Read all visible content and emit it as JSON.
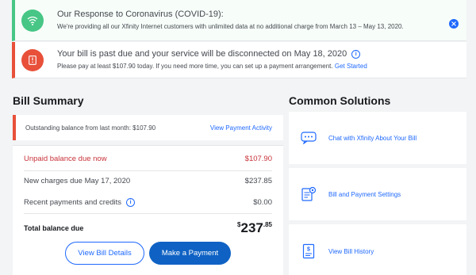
{
  "alerts": {
    "covid": {
      "title": "Our Response to Coronavirus (COVID-19):",
      "body": "We're providing all our Xfinity Internet customers with unlimited data at no additional charge from March 13 – May 13, 2020.",
      "icon": "wifi-icon"
    },
    "bill": {
      "title": "Your bill is past due and your service will be disconnected on May 18, 2020",
      "body": "Please pay at least $107.90 today. If you need more time, you can set up a payment arrangement.",
      "link": "Get Started",
      "icon": "bill-alert-icon"
    }
  },
  "bill_summary": {
    "heading": "Bill Summary",
    "outstanding": {
      "label": "Outstanding balance from last month: $107.90",
      "link": "View Payment Activity"
    },
    "rows": [
      {
        "label": "Unpaid balance due now",
        "value": "$107.90"
      },
      {
        "label": "New charges due May 17, 2020",
        "value": "$237.85"
      },
      {
        "label": "Recent payments and credits",
        "value": "$0.00"
      }
    ],
    "total": {
      "label": "Total balance due",
      "currency": "$",
      "dollars": "237",
      "cents": ".85"
    },
    "buttons": {
      "details": "View Bill Details",
      "pay": "Make a Payment"
    }
  },
  "solutions": {
    "heading": "Common Solutions",
    "items": [
      {
        "label": "Chat with Xfinity About Your Bill",
        "icon": "chat-icon"
      },
      {
        "label": "Bill and Payment Settings",
        "icon": "bill-settings-icon"
      },
      {
        "label": "View Bill History",
        "icon": "bill-history-icon"
      }
    ]
  },
  "colors": {
    "accent": "#1f69ff",
    "primary_button": "#0f62c4",
    "success": "#47c685",
    "danger": "#e8503a"
  }
}
